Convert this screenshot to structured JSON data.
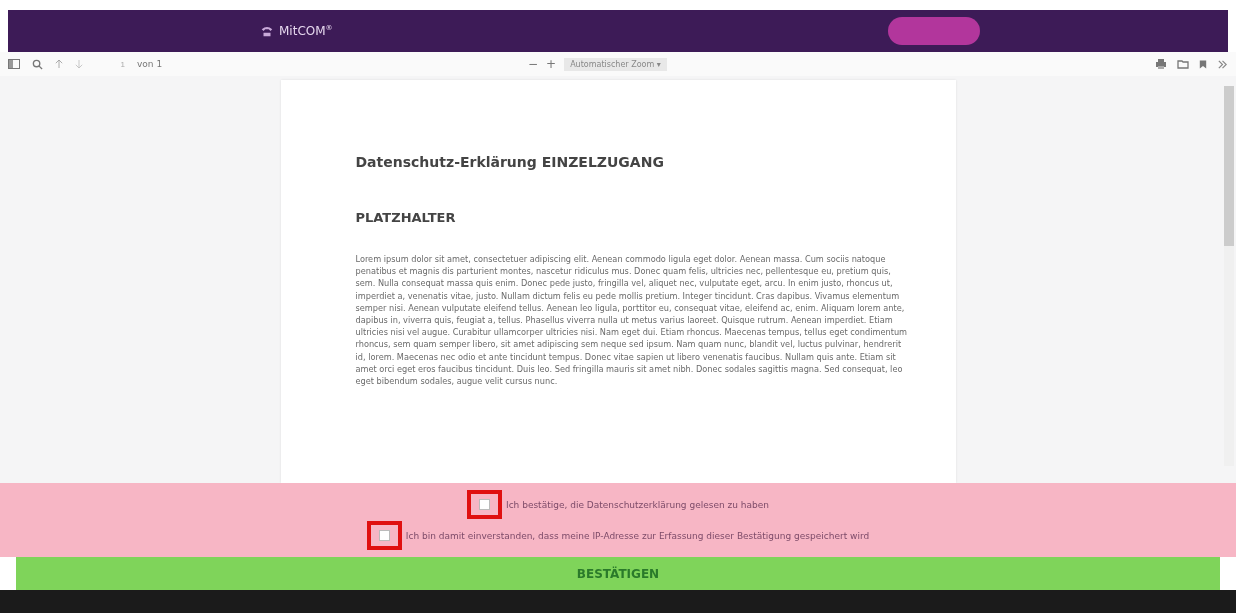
{
  "header": {
    "brand": "MitCOM",
    "brand_mark": "®"
  },
  "toolbar": {
    "page_number": "1",
    "page_count": "von 1",
    "zoom_out": "−",
    "zoom_in": "+",
    "zoom": "Automatischer Zoom",
    "zoom_caret": "▾"
  },
  "document": {
    "title": "Datenschutz-Erklärung EINZELZUGANG",
    "subtitle": "PLATZHALTER",
    "body": "Lorem ipsum dolor sit amet, consectetuer adipiscing elit. Aenean commodo ligula eget dolor. Aenean massa. Cum sociis natoque penatibus et magnis dis parturient montes, nascetur ridiculus mus. Donec quam felis, ultricies nec, pellentesque eu, pretium quis, sem. Nulla consequat massa quis enim. Donec pede justo, fringilla vel, aliquet nec, vulputate eget, arcu. In enim justo, rhoncus ut, imperdiet a, venenatis vitae, justo. Nullam dictum felis eu pede mollis pretium. Integer tincidunt. Cras dapibus. Vivamus elementum semper nisi. Aenean vulputate eleifend tellus. Aenean leo ligula, porttitor eu, consequat vitae, eleifend ac, enim. Aliquam lorem ante, dapibus in, viverra quis, feugiat a, tellus. Phasellus viverra nulla ut metus varius laoreet. Quisque rutrum. Aenean imperdiet. Etiam ultricies nisi vel augue. Curabitur ullamcorper ultricies nisi. Nam eget dui. Etiam rhoncus. Maecenas tempus, tellus eget condimentum rhoncus, sem quam semper libero, sit amet adipiscing sem neque sed ipsum. Nam quam nunc, blandit vel, luctus pulvinar, hendrerit id, lorem. Maecenas nec odio et ante tincidunt tempus. Donec vitae sapien ut libero venenatis faucibus. Nullam quis ante. Etiam sit amet orci eget eros faucibus tincidunt. Duis leo. Sed fringilla mauris sit amet nibh. Donec sodales sagittis magna. Sed consequat, leo eget bibendum sodales, augue velit cursus nunc."
  },
  "consents": [
    {
      "label": "Ich bestätige, die Datenschutzerklärung gelesen zu haben",
      "checked": false,
      "highlighted": true
    },
    {
      "label": "Ich bin damit einverstanden, dass meine IP-Adresse zur Erfassung dieser Bestätigung gespeichert wird",
      "checked": false,
      "highlighted": true
    }
  ],
  "confirm_button": "BESTÄTIGEN"
}
